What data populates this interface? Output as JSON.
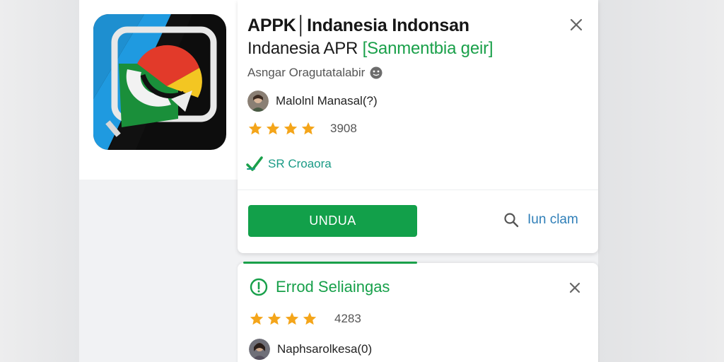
{
  "app": {
    "title_line1": "APPK│Indanesia Indonsan",
    "title_line2_main": "Indanesia APR ",
    "title_line2_accent": "[Sanmentbia geir]",
    "developer": "Asngar Oragutatalabir",
    "icon": "app-icon",
    "colors": {
      "accent_green": "#12a04a",
      "link_blue": "#2f7fb8",
      "verified_teal": "#1a9b86",
      "star_gold": "#f4a51a"
    }
  },
  "card1": {
    "author": "Malolnl Manasal(?)",
    "rating_stars": 4,
    "rating_count": "3908",
    "verified_label": "SR Croaora",
    "install_label": "UNDUA",
    "search_label": "Iun clam",
    "close_icon": "close-icon",
    "search_icon": "search-icon",
    "verified_icon": "check-icon",
    "info_icon": "info-icon"
  },
  "card2": {
    "title": "Errod Seliaingas",
    "rating_stars": 4,
    "rating_count": "4283",
    "author": "Naphsarolkesa(0)",
    "alert_icon": "alert-circle-icon",
    "close_icon": "close-icon"
  }
}
